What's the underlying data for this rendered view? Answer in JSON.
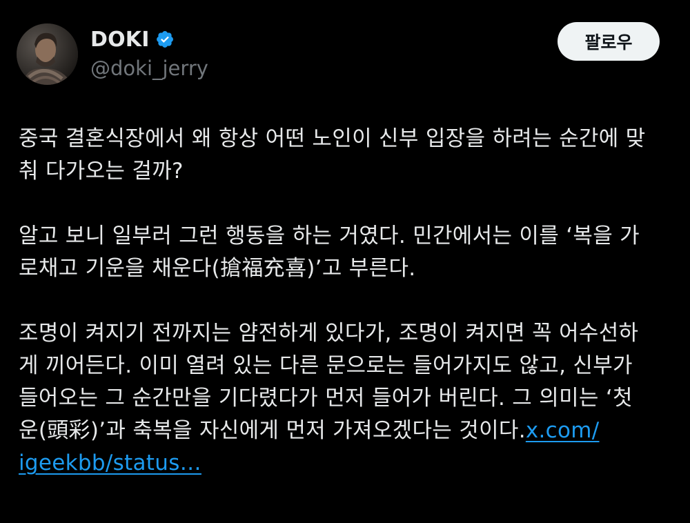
{
  "author": {
    "display_name": "DOKI",
    "handle": "@doki_jerry",
    "verified": true,
    "avatar_icon": "profile-photo"
  },
  "follow_button": {
    "label": "팔로우"
  },
  "tweet": {
    "paragraphs": [
      {
        "lines": [
          "중국 결혼식장에서 왜 항상 어떤 노인이 신부 입장을 하려는 순간에 맞",
          "춰 다가오는 걸까?"
        ]
      },
      {
        "lines": [
          "알고 보니 일부러 그런 행동을 하는 거였다. 민간에서는 이를 ‘복을 가",
          "로채고 기운을 채운다(搶福充喜)’고 부른다."
        ]
      },
      {
        "lines": [
          "조명이 켜지기 전까지는 얌전하게 있다가, 조명이 켜지면 꼭 어수선하",
          "게 끼어든다. 이미 열려 있는 다른 문으로는 들어가지도 않고, 신부가",
          "들어오는 그 순간만을 기다렸다가 먼저 들어가 버린다. 그 의미는 ‘첫",
          "운(頭彩)’과 축복을 자신에게 먼저 가져오겠다는 것이다."
        ],
        "link_part1": "x.com/",
        "link_part2": "igeekbb/status…"
      }
    ]
  },
  "colors": {
    "background": "#000000",
    "text": "#e7e9ea",
    "secondary_text": "#71767b",
    "link": "#1d9bf0",
    "verified_badge": "#1d9bf0",
    "button_bg": "#eff3f4"
  }
}
